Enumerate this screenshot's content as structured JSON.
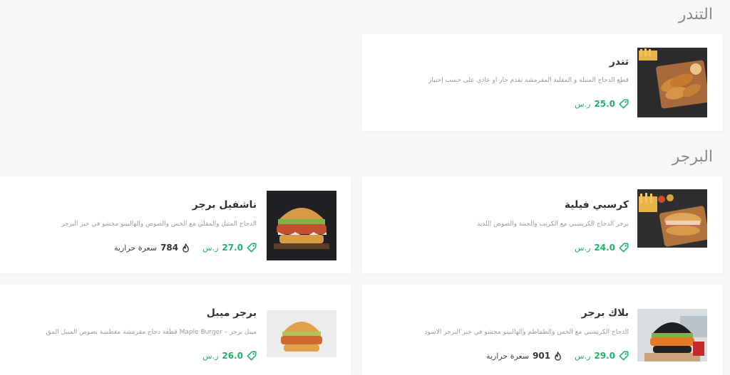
{
  "sections": [
    {
      "title": "التندر"
    },
    {
      "title": "البرجر"
    }
  ],
  "items": [
    {
      "name": "تندر",
      "description": "قطع الدجاج المتبلة و المقلية المقرمشة تقدم حار او عادي على حسب إختيار",
      "price": "25.0",
      "currency": "ر.س",
      "image": "tenders-plate-photo"
    },
    {
      "name": "كرسبي فيلية",
      "description": "برجر الدجاج الكريسبي مع الكرنب والجبنة والصوص اللذيذ",
      "price": "24.0",
      "currency": "ر.س",
      "image": "crispy-fillet-photo"
    },
    {
      "name": "ناشفيل برجر",
      "description": "الدجاج المتبل والمقلي مع الخس والصوص والهالبينو محشو في خبز البرجر",
      "price": "27.0",
      "currency": "ر.س",
      "calories": "784",
      "calories_label": "سعرة حرارية",
      "image": "nashville-burger-photo"
    },
    {
      "name": "بلاك برجر",
      "description": "الدجاج الكريسبي مع الخس والطماطم والهالبينو محشو في خبز البرجر الأسود",
      "price": "29.0",
      "currency": "ر.س",
      "calories": "901",
      "calories_label": "سعرة حرارية",
      "image": "black-burger-photo"
    },
    {
      "name": "برجر ميبل",
      "description": "ميبل برجر – Maple Burger قطعة دجاج مقرمشة مغطسة بصوص الميبل المق",
      "price": "26.0",
      "currency": "ر.س",
      "image": "maple-burger-photo"
    }
  ],
  "colors": {
    "accent": "#1fb26b",
    "title": "#333333",
    "muted": "#9b9b9b",
    "section": "#8a8a8a"
  },
  "icons": {
    "price": "price-tag-icon",
    "calories": "flame-icon"
  }
}
